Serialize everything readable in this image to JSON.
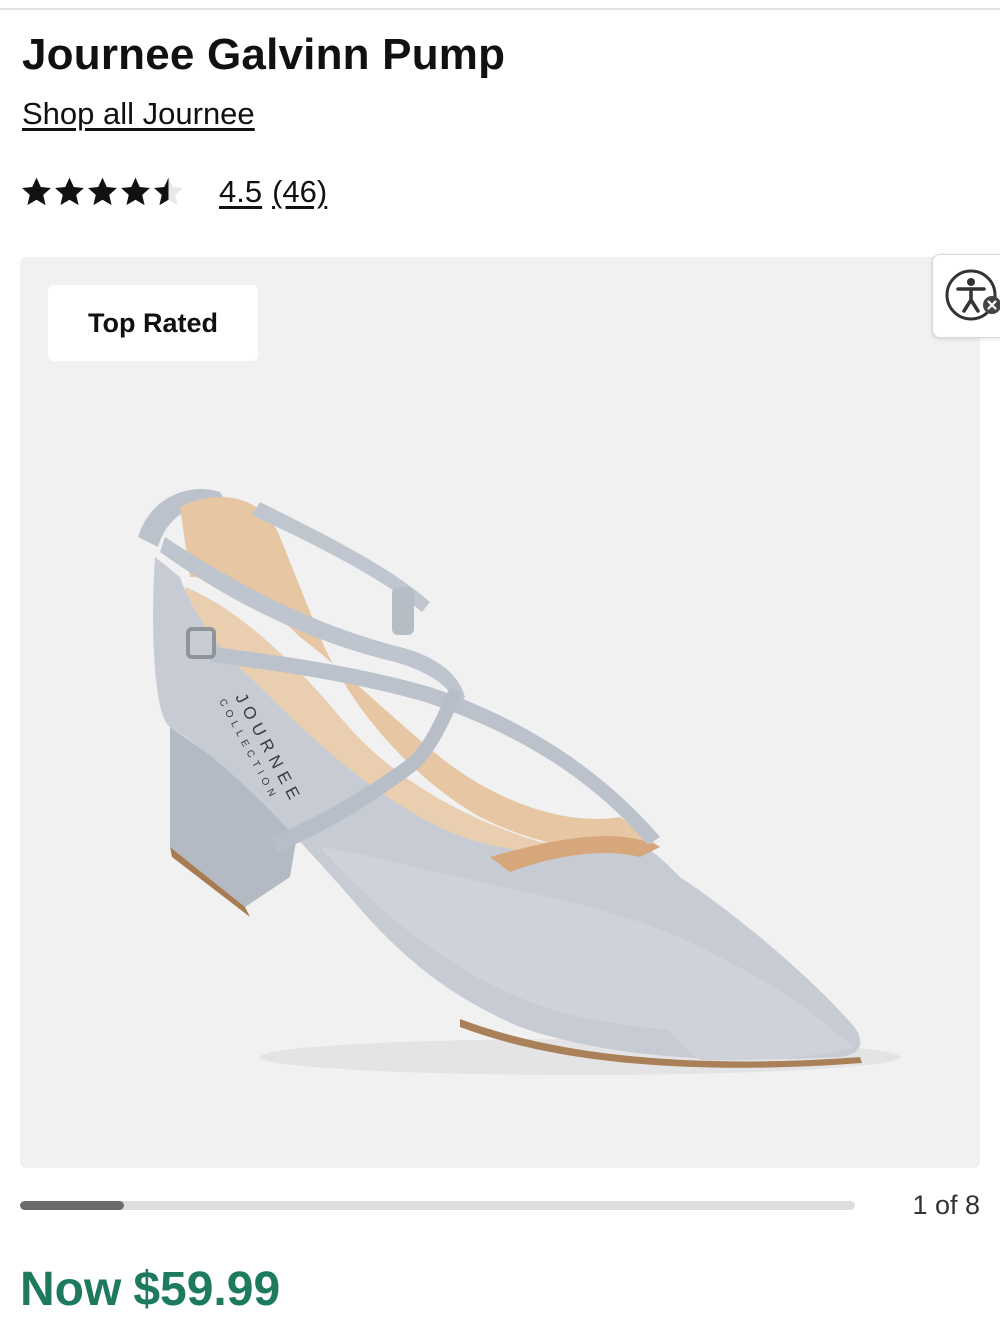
{
  "product": {
    "title": "Journee Galvinn Pump",
    "brand_link": "Shop all Journee",
    "rating_value": "4.5",
    "review_count": "(46)",
    "rating_stars": 4.5,
    "rating_max": 5,
    "badge": "Top Rated"
  },
  "gallery": {
    "counter": "1 of 8",
    "current_image": 1,
    "total_images": 8
  },
  "pricing": {
    "prefix": "Now",
    "amount": "$59.99"
  },
  "colors": {
    "price": "#1e7a5f",
    "gallery_bg": "#f1f1f2",
    "progress_fill": "#6b6b6b",
    "shoe_leather": "#c4c9d1",
    "shoe_lining": "#e3c3a0"
  },
  "icons": {
    "accessibility": "accessibility-icon",
    "star": "star-icon"
  }
}
